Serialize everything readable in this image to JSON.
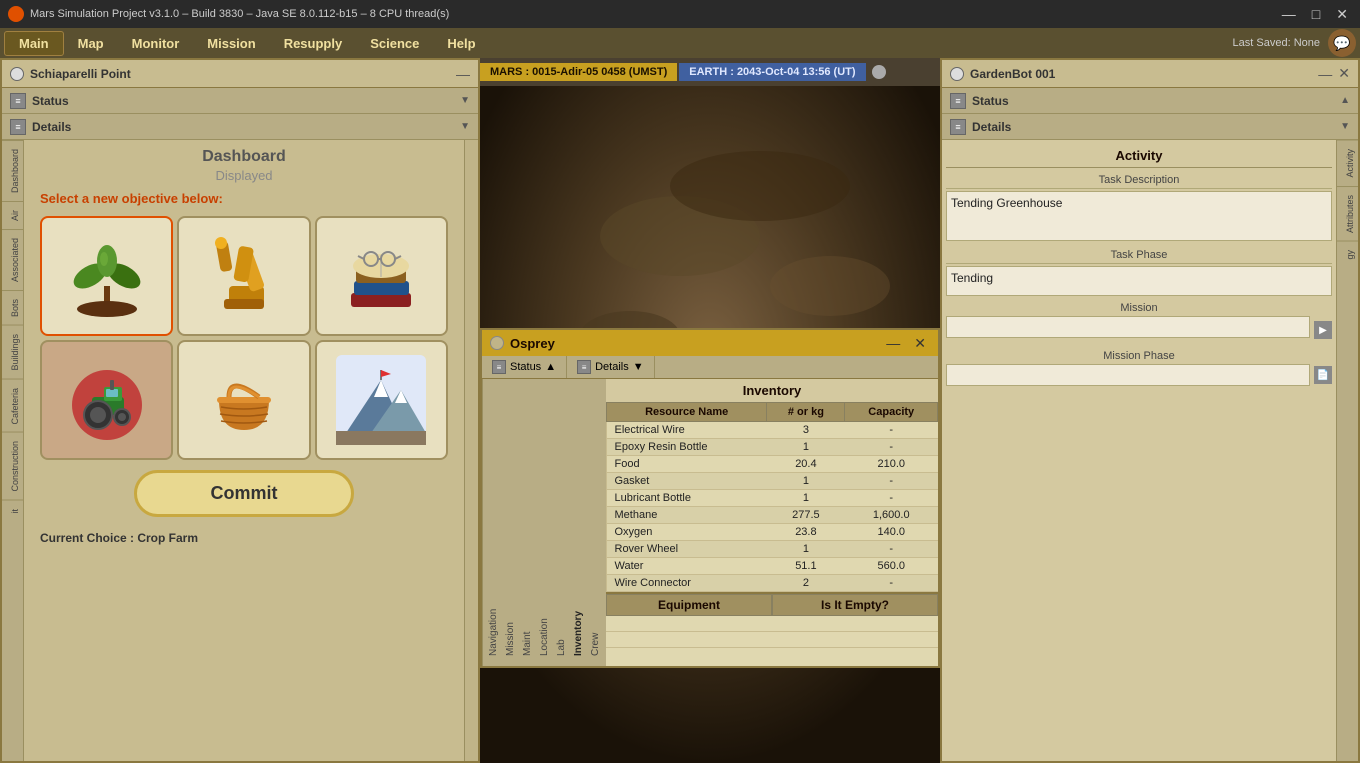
{
  "titlebar": {
    "title": "Mars Simulation Project v3.1.0 – Build 3830 – Java SE 8.0.112-b15 – 8 CPU thread(s)",
    "icon": "mars-icon"
  },
  "menubar": {
    "items": [
      "Main",
      "Map",
      "Monitor",
      "Mission",
      "Resupply",
      "Science",
      "Help"
    ],
    "active": "Main",
    "last_saved": "Last Saved: None"
  },
  "mars_time": "MARS : 0015-Adir-05 0458 (UMST)",
  "earth_time": "EARTH : 2043-Oct-04  13:56 (UT)",
  "left_panel": {
    "title": "Schiaparelli Point",
    "sections": [
      {
        "label": "Status",
        "expanded": false
      },
      {
        "label": "Details",
        "expanded": false
      }
    ],
    "dashboard": {
      "title": "Dashboard",
      "subtitle": "Displayed",
      "objective_label": "Select a new objective below:",
      "objectives": [
        {
          "id": "crop-farm",
          "label": "Crop Farm",
          "selected": true
        },
        {
          "id": "robot",
          "label": "Robot",
          "selected": false
        },
        {
          "id": "research",
          "label": "Research",
          "selected": false
        },
        {
          "id": "tractor",
          "label": "Tractor",
          "selected": false
        },
        {
          "id": "trade",
          "label": "Trade",
          "selected": false
        },
        {
          "id": "exploration",
          "label": "Exploration",
          "selected": false
        }
      ],
      "commit_btn": "Commit",
      "current_choice": "Current Choice : Crop Farm"
    },
    "left_tabs": [
      "Air",
      "Associated",
      "Bots",
      "Buildings",
      "Cafeteria",
      "Construction",
      "it"
    ]
  },
  "osprey_dialog": {
    "title": "Osprey",
    "tabs": [
      {
        "label": "Status"
      },
      {
        "label": "Details"
      }
    ],
    "sidebar_tabs": [
      "Crew",
      "Inventory",
      "Lab",
      "Location",
      "Maint",
      "Mission",
      "Navigation"
    ],
    "inventory": {
      "title": "Inventory",
      "columns": [
        "Resource Name",
        "# or kg",
        "Capacity"
      ],
      "rows": [
        {
          "name": "Electrical Wire",
          "amount": "3",
          "capacity": "-"
        },
        {
          "name": "Epoxy Resin Bottle",
          "amount": "1",
          "capacity": "-"
        },
        {
          "name": "Food",
          "amount": "20.4",
          "capacity": "210.0"
        },
        {
          "name": "Gasket",
          "amount": "1",
          "capacity": "-"
        },
        {
          "name": "Lubricant Bottle",
          "amount": "1",
          "capacity": "-"
        },
        {
          "name": "Methane",
          "amount": "277.5",
          "capacity": "1,600.0"
        },
        {
          "name": "Oxygen",
          "amount": "23.8",
          "capacity": "140.0"
        },
        {
          "name": "Rover Wheel",
          "amount": "1",
          "capacity": "-"
        },
        {
          "name": "Water",
          "amount": "51.1",
          "capacity": "560.0"
        },
        {
          "name": "Wire Connector",
          "amount": "2",
          "capacity": "-"
        }
      ],
      "equipment_cols": [
        "Equipment",
        "Is It Empty?"
      ]
    }
  },
  "right_panel": {
    "title": "GardenBot 001",
    "sections": [
      {
        "label": "Status",
        "expanded": false
      },
      {
        "label": "Details",
        "expanded": false
      }
    ],
    "activity": {
      "title": "Activity",
      "task_description_label": "Task Description",
      "task_description": "Tending Greenhouse",
      "task_phase_label": "Task Phase",
      "task_phase": "Tending",
      "mission_label": "Mission",
      "mission_value": "",
      "mission_phase_label": "Mission Phase",
      "mission_phase_value": ""
    },
    "right_tabs": [
      "Activity",
      "Attributes",
      "gy"
    ]
  }
}
